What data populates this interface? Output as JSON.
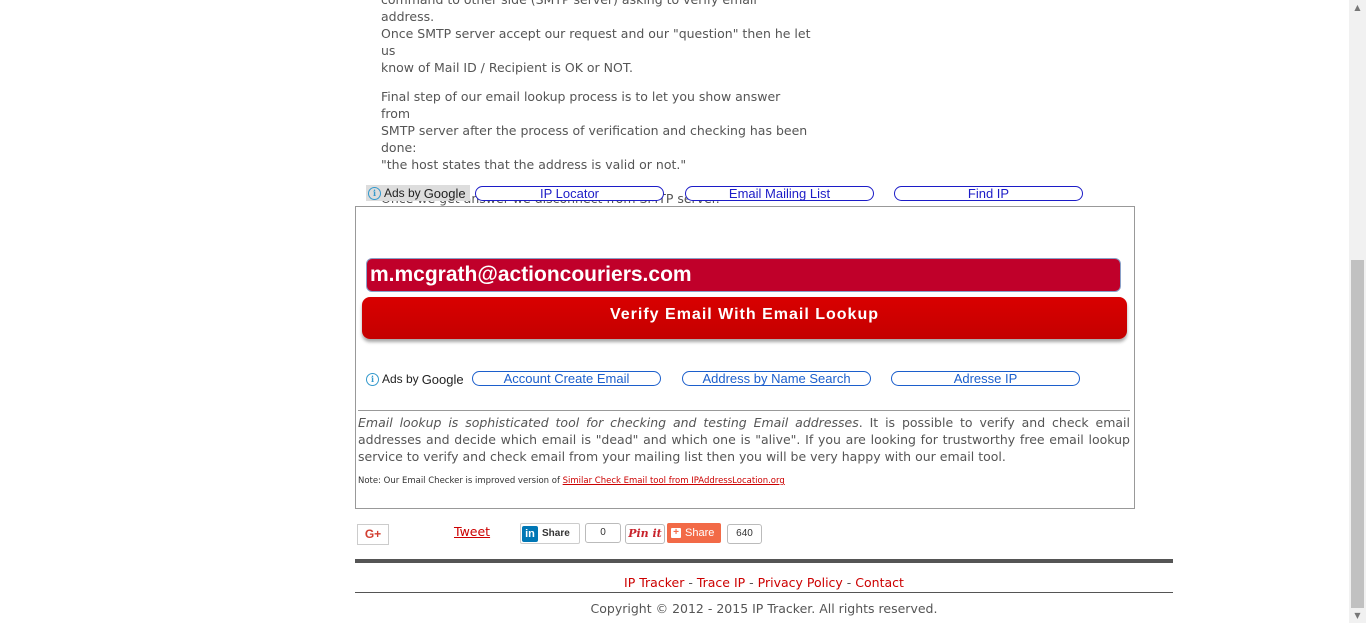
{
  "article": {
    "paragraph1_lines": [
      "command to other side (SMTP server) asking to verify email address.",
      "Once SMTP server accept our request and our \"question\" then he let us",
      "know of Mail ID / Recipient is OK or NOT."
    ],
    "paragraph2_lines": [
      "Final step of our email lookup process is to let you show answer from",
      "SMTP server after the process of verification and checking has been",
      "done:",
      "\"the host states that the address is valid or not.\""
    ],
    "paragraph3": "Once we get answer we disconnect from SMTP server."
  },
  "ads_top": {
    "label_ads_by": "Ads by",
    "label_google": "Google",
    "links": [
      "IP Locator",
      "Email Mailing List",
      "Find IP"
    ]
  },
  "email_form": {
    "input_value": "m.mcgrath@actioncouriers.com",
    "button_label": "Verify Email With Email Lookup"
  },
  "ads_mid": {
    "label_ads_by": "Ads by",
    "label_google": "Google",
    "links": [
      "Account Create Email",
      "Address by Name Search",
      "Adresse IP"
    ]
  },
  "description": {
    "lead_italic": "Email lookup is sophisticated tool for checking and testing Email addresses",
    "rest": ". It is possible to verify and check email addresses and decide which email is \"dead\" and which one is \"alive\". If you are looking for trustworthy free email lookup service to verify and check email from your mailing list then you will be very happy with our email tool."
  },
  "note": {
    "prefix": "Note: Our Email Checker is improved version of ",
    "link_text": "Similar Check Email tool from IPAddressLocation.org"
  },
  "share": {
    "gplus_label": "G+",
    "tweet_label": "Tweet",
    "linkedin_logo": "in",
    "linkedin_label": "Share",
    "linkedin_count": "0",
    "pinterest_label": "Pin it",
    "addthis_label": "Share",
    "addthis_count": "640"
  },
  "footer": {
    "links": [
      "IP Tracker",
      "Trace IP",
      "Privacy Policy",
      "Contact"
    ],
    "separator": " - ",
    "copyright": "Copyright © 2012 - 2015 IP Tracker. All rights reserved."
  },
  "colors": {
    "accent_red": "#c40000",
    "link_blue": "#1c1cc7",
    "footer_link": "#cc0000"
  }
}
